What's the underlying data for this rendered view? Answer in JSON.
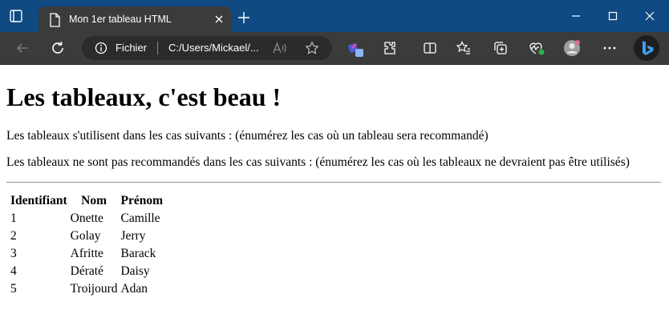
{
  "browser": {
    "tab_title": "Mon 1er tableau HTML",
    "address_scheme": "Fichier",
    "address_url": "C:/Users/Mickael/...",
    "colors": {
      "titlebar": "#0f4a82",
      "toolbar": "#3b3b3b",
      "omnibox": "#2b2b2b"
    }
  },
  "page": {
    "heading": "Les tableaux, c'est beau !",
    "para_recommended": "Les tableaux s'utilisent dans les cas suivants : (énumérez les cas où un tableau sera recommandé)",
    "para_not_recommended": "Les tableaux ne sont pas recommandés dans les cas suivants : (énumérez les cas où les tableaux ne devraient pas être utilisés)",
    "table": {
      "headers": [
        "Identifiant",
        "Nom",
        "Prénom"
      ],
      "rows": [
        [
          "1",
          "Onette",
          "Camille"
        ],
        [
          "2",
          "Golay",
          "Jerry"
        ],
        [
          "3",
          "Afritte",
          "Barack"
        ],
        [
          "4",
          "Dératé",
          "Daisy"
        ],
        [
          "5",
          "Troijourd",
          "Adan"
        ]
      ]
    }
  },
  "icons": [
    "tab-actions-icon",
    "page-icon",
    "close-icon",
    "new-tab-icon",
    "minimize-icon",
    "maximize-icon",
    "window-close-icon",
    "back-icon",
    "refresh-icon",
    "info-icon",
    "read-aloud-icon",
    "favorite-icon",
    "extension-color-icon",
    "extensions-icon",
    "split-screen-icon",
    "favorites-icon",
    "collections-icon",
    "performance-icon",
    "profile-icon",
    "more-icon",
    "bing-icon"
  ]
}
